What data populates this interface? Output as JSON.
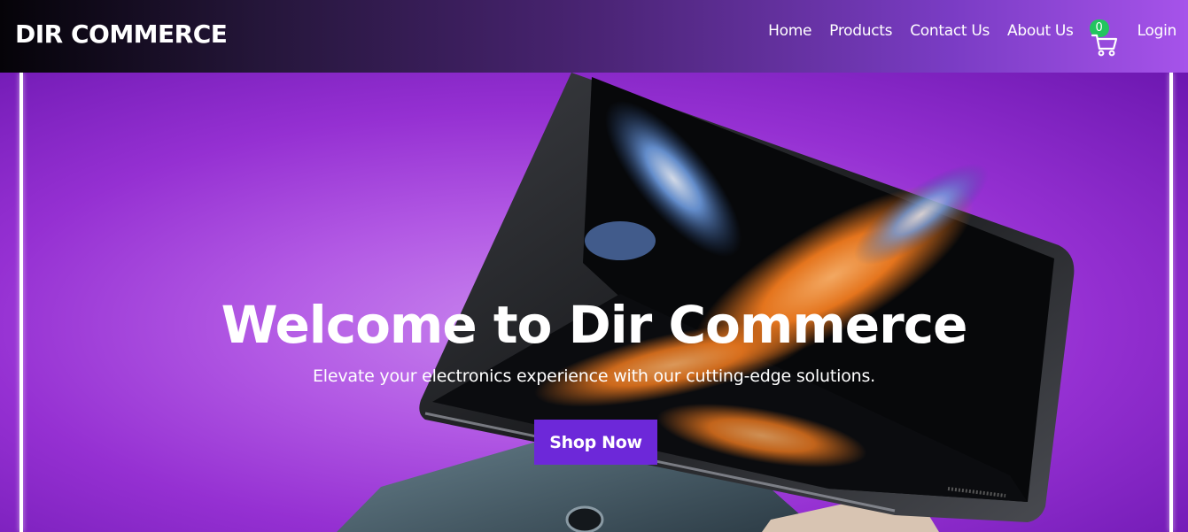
{
  "brand": {
    "name": "DIR COMMERCE"
  },
  "nav": {
    "items": [
      {
        "label": "Home"
      },
      {
        "label": "Products"
      },
      {
        "label": "Contact Us"
      },
      {
        "label": "About Us"
      }
    ],
    "cart_count": "0",
    "login_label": "Login"
  },
  "hero": {
    "title": "Welcome to Dir Commerce",
    "subtitle": "Elevate your electronics experience with our cutting-edge solutions.",
    "cta_label": "Shop Now"
  },
  "colors": {
    "accent_button": "#6d28d9",
    "cart_badge": "#22c55e",
    "hero_background": "#a646dc"
  },
  "icons": {
    "cart": "shopping-cart-icon"
  }
}
